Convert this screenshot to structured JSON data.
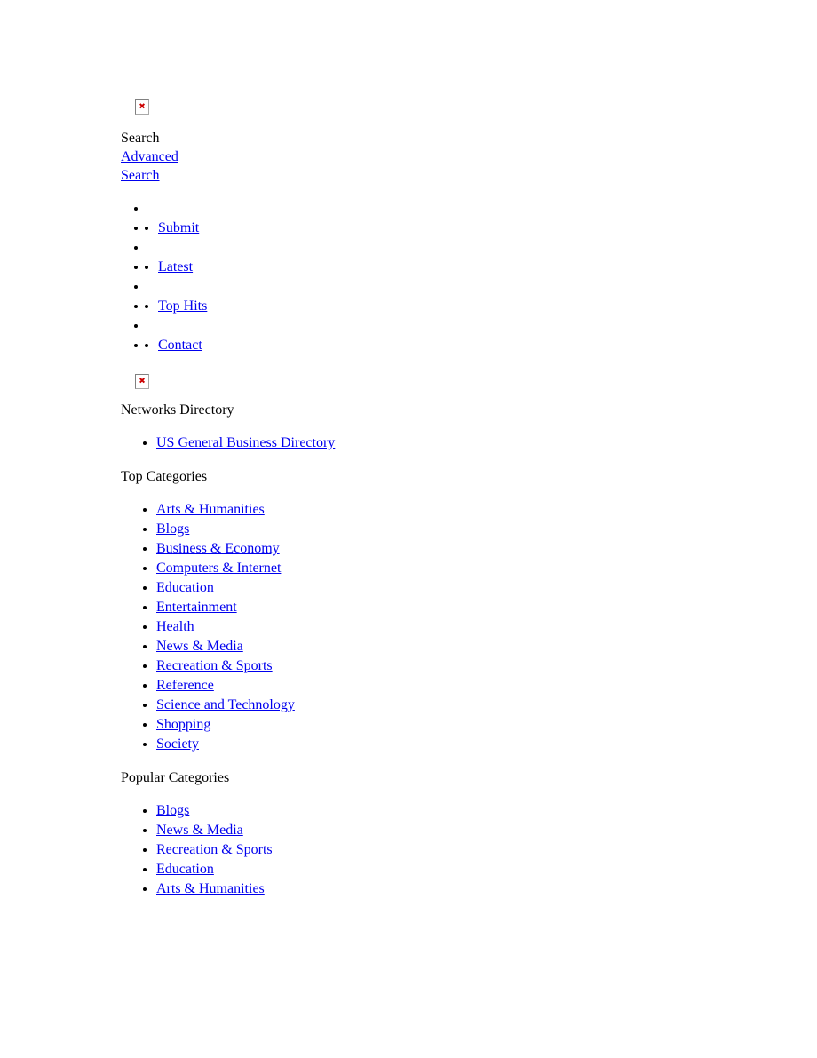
{
  "page": {
    "title": "Networks Directory"
  },
  "header": {
    "logo_icon": "broken-image-icon",
    "search_label": "Search",
    "advanced_search_label": "Advanced Search"
  },
  "nav": {
    "items": [
      {
        "label": "",
        "empty": true
      },
      {
        "label": "Submit",
        "empty": false
      },
      {
        "label": "",
        "empty": true
      },
      {
        "label": "Latest",
        "empty": false
      },
      {
        "label": "",
        "empty": true
      },
      {
        "label": "Top Hits",
        "empty": false
      },
      {
        "label": "",
        "empty": true
      },
      {
        "label": "Contact",
        "empty": false
      }
    ]
  },
  "site": {
    "banner_icon": "broken-image-icon",
    "name": "Networks Directory",
    "featured": [
      "US General Business Directory"
    ]
  },
  "top_categories": {
    "heading": "Top Categories",
    "items": [
      "Arts & Humanities",
      "Blogs",
      "Business & Economy",
      "Computers & Internet",
      "Education",
      "Entertainment",
      "Health",
      "News & Media",
      "Recreation & Sports",
      "Reference",
      "Science and Technology",
      "Shopping",
      "Society"
    ]
  },
  "popular_categories": {
    "heading": "Popular Categories",
    "items": [
      "Blogs",
      "News & Media",
      "Recreation & Sports",
      "Education",
      "Arts & Humanities"
    ]
  },
  "colors": {
    "link": "#0000ee",
    "text": "#000000",
    "background": "#ffffff",
    "broken_icon_mark": "#cc0000",
    "broken_icon_border": "#808080"
  }
}
